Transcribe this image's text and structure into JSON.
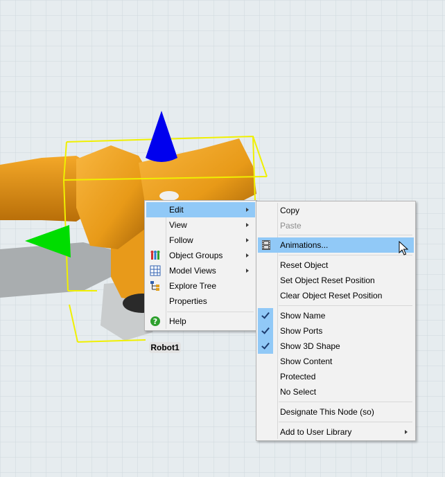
{
  "scene": {
    "object_label": "Robot1"
  },
  "left_menu": {
    "items": [
      {
        "label": "Edit",
        "submenu": true,
        "icon": null,
        "hover": true
      },
      {
        "label": "View",
        "submenu": true,
        "icon": null
      },
      {
        "label": "Follow",
        "submenu": true,
        "icon": null
      },
      {
        "label": "Object Groups",
        "submenu": true,
        "icon": "object-groups-icon"
      },
      {
        "label": "Model Views",
        "submenu": true,
        "icon": "model-views-icon"
      },
      {
        "label": "Explore Tree",
        "submenu": false,
        "icon": "explore-tree-icon"
      },
      {
        "label": "Properties",
        "submenu": false,
        "icon": null
      },
      {
        "label": "Help",
        "submenu": false,
        "icon": "help-icon"
      }
    ]
  },
  "right_menu": {
    "items": [
      {
        "label": "Copy"
      },
      {
        "label": "Paste",
        "disabled": true
      },
      {
        "label": "Animations...",
        "icon": "film-strip-icon",
        "hover": true
      },
      {
        "label": "Reset Object"
      },
      {
        "label": "Set Object Reset Position"
      },
      {
        "label": "Clear Object Reset Position"
      },
      {
        "label": "Show Name",
        "checked": true
      },
      {
        "label": "Show Ports",
        "checked": true
      },
      {
        "label": "Show 3D Shape",
        "checked": true
      },
      {
        "label": "Show Content"
      },
      {
        "label": "Protected"
      },
      {
        "label": "No Select"
      },
      {
        "label": "Designate This Node (so)"
      },
      {
        "label": "Add to User Library",
        "submenu": true
      }
    ]
  },
  "colors": {
    "highlight": "#91c9f7",
    "menu_bg": "#f2f2f2",
    "robot_orange": "#f0a020",
    "selection_box": "#ffff00",
    "axis_z": "#0000ee",
    "axis_x": "#00cc00"
  }
}
